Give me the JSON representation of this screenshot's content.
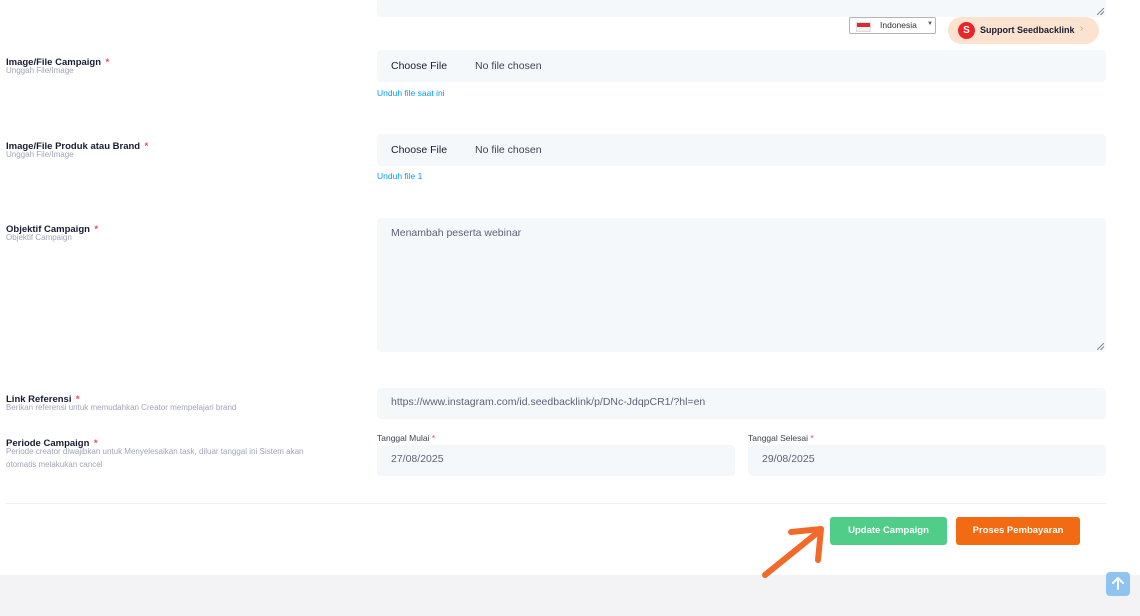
{
  "language": {
    "selected": "Indonesia"
  },
  "support": {
    "label": "Support Seedbacklink",
    "logo_letter": "S"
  },
  "fields": {
    "campaign_image": {
      "label": "Image/File Campaign",
      "required_mark": "*",
      "hint": "Unggah File/Image",
      "button": "Choose File",
      "value": "No file chosen",
      "link": "Unduh file saat ini"
    },
    "product_image": {
      "label": "Image/File Produk atau Brand",
      "required_mark": "*",
      "hint": "Unggah File/Image",
      "button": "Choose File",
      "value": "No file chosen",
      "link": "Unduh file 1"
    },
    "objective": {
      "label": "Objektif Campaign",
      "required_mark": "*",
      "hint": "Objektif Campaign",
      "value": "Menambah peserta webinar"
    },
    "reference": {
      "label": "Link Referensi",
      "required_mark": "*",
      "hint": "Berikan referensi untuk memudahkan Creator mempelajari brand",
      "value": "https://www.instagram.com/id.seedbacklink/p/DNc-JdqpCR1/?hl=en"
    },
    "period": {
      "label": "Periode Campaign",
      "required_mark": "*",
      "hint_line1": "Periode creator diwajibkan untuk Menyelesaikan task, diluar tanggal ini Sistem akan",
      "hint_line2": "otomatis melakukan cancel",
      "start_label": "Tanggal Mulai",
      "start_value": "27/08/2025",
      "end_label": "Tanggal Selesai",
      "end_value": "29/08/2025"
    }
  },
  "actions": {
    "update_label": "Update Campaign",
    "payment_label": "Proses Pembayaran"
  },
  "colors": {
    "update_button": "#50cd89",
    "payment_button": "#f26a12",
    "arrow": "#f26a2a",
    "link": "#009ef7",
    "required": "#f1416c",
    "scroll_top": "#8fc3f0"
  },
  "icons": [
    "flag-indonesia-icon",
    "caret-down-icon",
    "seedbacklink-logo-icon",
    "chevron-right-icon",
    "resize-grip-icon",
    "arrow-annotation-icon",
    "arrow-up-icon"
  ]
}
